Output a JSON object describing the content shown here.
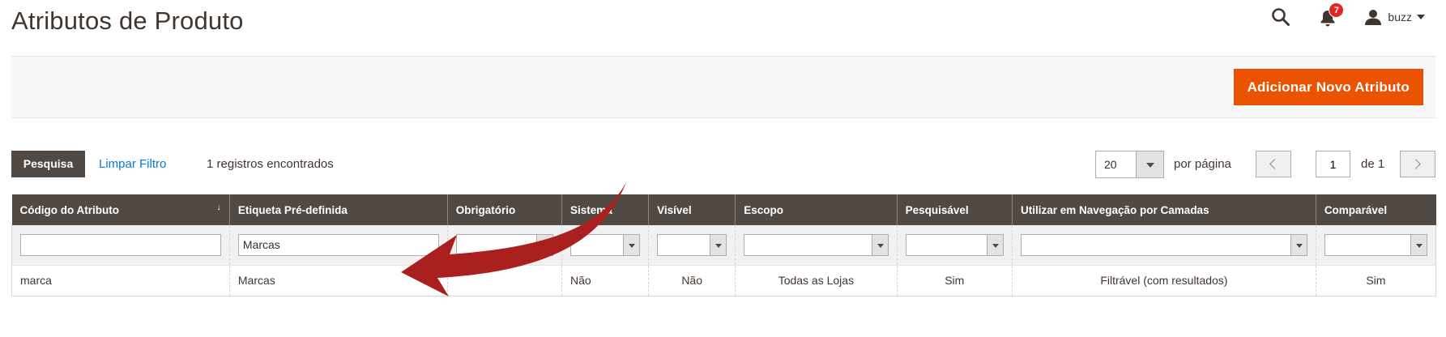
{
  "page": {
    "title": "Atributos de Produto"
  },
  "header": {
    "notifications_count": "7",
    "user_name": "buzz",
    "icons": {
      "search": "search-icon",
      "notifications": "bell-icon",
      "user": "user-icon"
    }
  },
  "actions": {
    "add_button_label": "Adicionar Novo Atributo"
  },
  "toolbar": {
    "search_label": "Pesquisa",
    "reset_label": "Limpar Filtro",
    "records_text": "1 registros encontrados",
    "per_page_value": "20",
    "per_page_label": "por página",
    "current_page": "1",
    "total_pages_text": "de 1"
  },
  "grid": {
    "columns": [
      {
        "label": "Código do Atributo",
        "sorted": "desc"
      },
      {
        "label": "Etiqueta Pré-definida"
      },
      {
        "label": "Obrigatório"
      },
      {
        "label": "Sistema"
      },
      {
        "label": "Visível"
      },
      {
        "label": "Escopo"
      },
      {
        "label": "Pesquisável"
      },
      {
        "label": "Utilizar em Navegação por Camadas"
      },
      {
        "label": "Comparável"
      }
    ],
    "sort_indicator": "↓",
    "filters": {
      "attribute_code": "",
      "default_label": "Marcas"
    },
    "rows": [
      {
        "attribute_code": "marca",
        "default_label": "Marcas",
        "required": "",
        "system": "Não",
        "visible": "Não",
        "scope": "Todas as Lojas",
        "searchable": "Sim",
        "layered_navigation": "Filtrável (com resultados)",
        "comparable": "Sim"
      }
    ]
  },
  "colors": {
    "accent": "#eb5202",
    "header_bg": "#514943",
    "link": "#007bdb",
    "annotation_arrow": "#a9201f",
    "badge": "#e22626"
  }
}
